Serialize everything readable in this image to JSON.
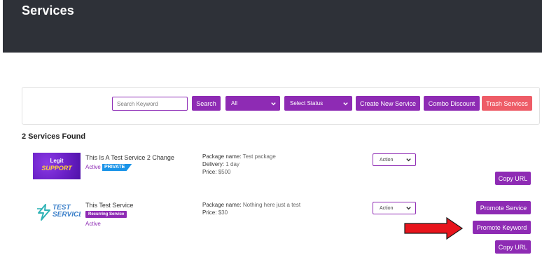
{
  "page": {
    "title": "Services"
  },
  "filters": {
    "search_placeholder": "Search Keyword",
    "search_label": "Search",
    "category_value": "All",
    "status_value": "Select Status",
    "create_label": "Create New Service",
    "combo_label": "Combo Discount",
    "trash_label": "Trash Services"
  },
  "results": {
    "count_text": "2 Services Found"
  },
  "services": [
    {
      "thumb_line1": "Legit",
      "thumb_line2": "SUPPORT",
      "title": "This Is A Test Service 2 Change",
      "status": "Active",
      "badge": "PRIVATE",
      "package_key": "Package name:",
      "package_value": "Test package",
      "delivery_key": "Delivery:",
      "delivery_value": "1 day",
      "price_key": "Price:",
      "price_value": "$500",
      "action_label": "Action",
      "copy_label": "Copy URL"
    },
    {
      "thumb_line1": "TEST",
      "thumb_line2": "SERVICE",
      "title": "This Test Service",
      "badge": "Recurring Service",
      "status": "Active",
      "package_key": "Package name:",
      "package_value": "Nothing here just a test",
      "price_key": "Price:",
      "price_value": "$30",
      "action_label": "Action",
      "promote_service_label": "Promote Service",
      "promote_keyword_label": "Promote Keyword",
      "copy_label": "Copy URL"
    }
  ],
  "colors": {
    "header_bg": "#2e3138",
    "accent_purple": "#8e2bb4",
    "trash_red": "#ee5c67",
    "private_blue": "#1a94e8",
    "annotation_arrow": "#e8141c"
  },
  "icons": {
    "dropdown": "chevron-down-icon",
    "annotation": "red-arrow-icon",
    "test_logo": "lightning-bolt-icon"
  }
}
